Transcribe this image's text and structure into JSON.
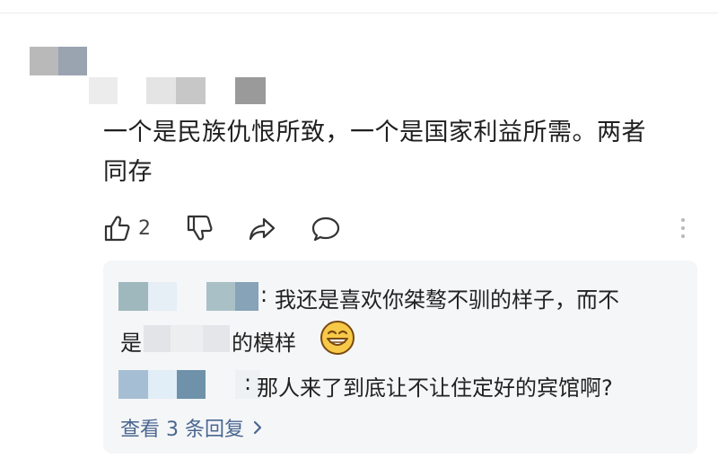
{
  "comment": {
    "text_line1": "一个是民族仇恨所致，一个是国家利益所需。两者",
    "text_line2": "同存",
    "likes": "2"
  },
  "replies": [
    {
      "separator": ":",
      "text_line1": "我还是喜欢你桀骜不驯的样子，而不",
      "text_line2_start": "是",
      "text_line2_end": "的模样",
      "emoji": "grinning-face-emoji"
    },
    {
      "separator": ":",
      "text": "那人来了到底让不让住定好的宾馆啊?"
    }
  ],
  "view_replies_label": "查看 3 条回复",
  "colors": {
    "link": "#4a6790",
    "reply_bg": "#f5f6f8",
    "emoji_fill": "#f7c948"
  }
}
